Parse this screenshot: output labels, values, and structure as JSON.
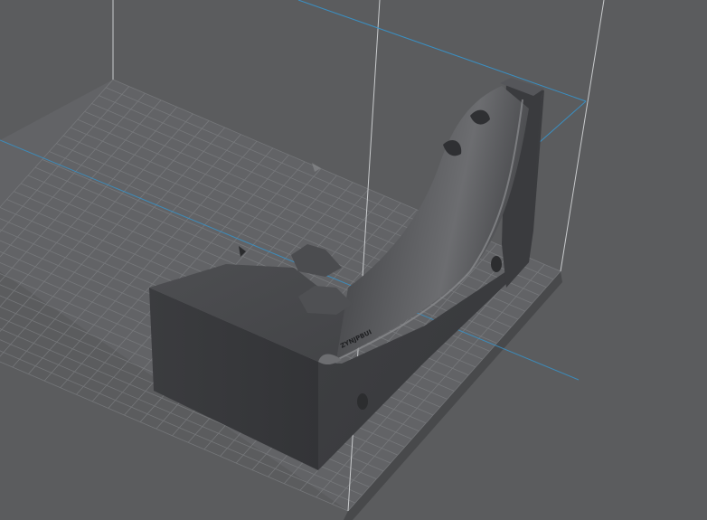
{
  "viewport": {
    "background_color": "#5b5c5e",
    "grid_color": "#7d7f82",
    "volume_outline_color": "#c9cbcd",
    "volume_top_edge_color": "#3a8fc2"
  },
  "model": {
    "color": "#3f4043",
    "embossed_text": "ZYNJPBUI"
  }
}
